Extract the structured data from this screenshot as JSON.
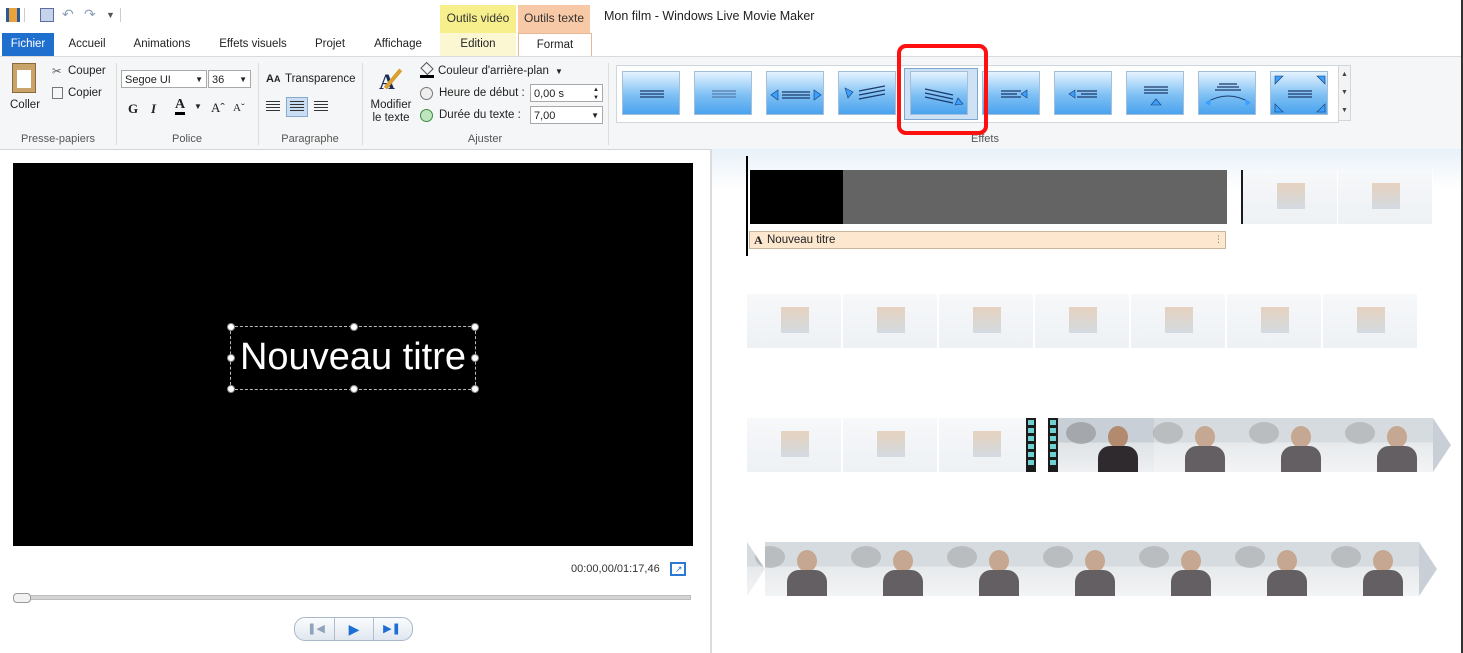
{
  "window": {
    "title": "Mon film - Windows Live Movie Maker"
  },
  "context_tabs": {
    "video_tools": "Outils vidéo",
    "text_tools": "Outils texte"
  },
  "tabs": [
    "Fichier",
    "Accueil",
    "Animations",
    "Effets visuels",
    "Projet",
    "Affichage",
    "Edition",
    "Format"
  ],
  "ribbon": {
    "clipboard": {
      "paste": "Coller",
      "cut": "Couper",
      "copy": "Copier",
      "group": "Presse-papiers"
    },
    "font": {
      "family": "Segoe UI",
      "size": "36",
      "bold": "G",
      "italic": "I",
      "group": "Police"
    },
    "paragraph": {
      "transparency": "Transparence",
      "group": "Paragraphe"
    },
    "adjust": {
      "edit_text_line1": "Modifier",
      "edit_text_line2": "le texte",
      "bg_color": "Couleur d'arrière-plan",
      "start_time_label": "Heure de début :",
      "start_time_value": "0,00 s",
      "duration_label": "Durée du texte :",
      "duration_value": "7,00",
      "group": "Ajuster"
    },
    "effects": {
      "group": "Effets",
      "selected_index": 4
    }
  },
  "preview": {
    "title_text": "Nouveau titre",
    "timecode": "00:00,00/01:17,46",
    "progress": 0
  },
  "storyboard": {
    "caption": "Nouveau titre"
  },
  "colors": {
    "accent": "#1f6fcf",
    "video_tools": "#f6ef8c",
    "text_tools": "#f8c9a7",
    "highlight": "#ff1010",
    "caption_bg": "#fde7cf"
  }
}
